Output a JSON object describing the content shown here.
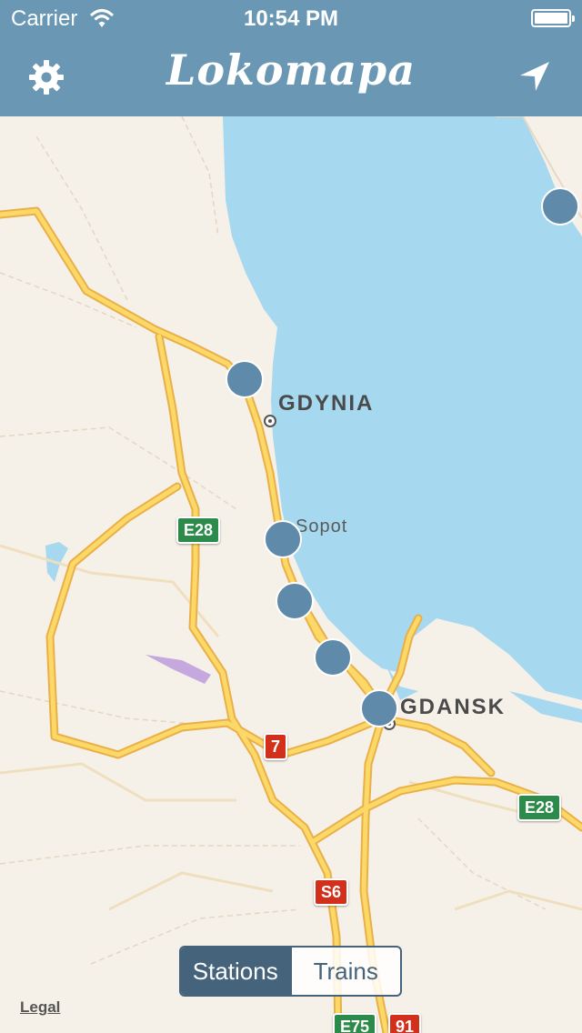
{
  "status_bar": {
    "carrier": "Carrier",
    "time": "10:54 PM"
  },
  "nav_bar": {
    "title": "Lokomapa",
    "left_icon": "gear-icon",
    "right_icon": "location-arrow-icon"
  },
  "map": {
    "cities": {
      "gdynia": "GDYNIA",
      "gdansk": "GDANSK",
      "sopot": "Sopot"
    },
    "road_badges": [
      "E28",
      "7",
      "E28",
      "S6",
      "E75",
      "91"
    ],
    "station_count": 6,
    "water_color": "#a6d8ef",
    "land_color": "#f6f1e8",
    "road_color": "#fbc94a"
  },
  "segmented_control": {
    "options": [
      "Stations",
      "Trains"
    ],
    "selected": "Stations"
  },
  "legal_link": "Legal",
  "colors": {
    "nav_background": "#6a97b3",
    "station_marker": "#5f8aa9",
    "segment_active": "#45647c"
  }
}
